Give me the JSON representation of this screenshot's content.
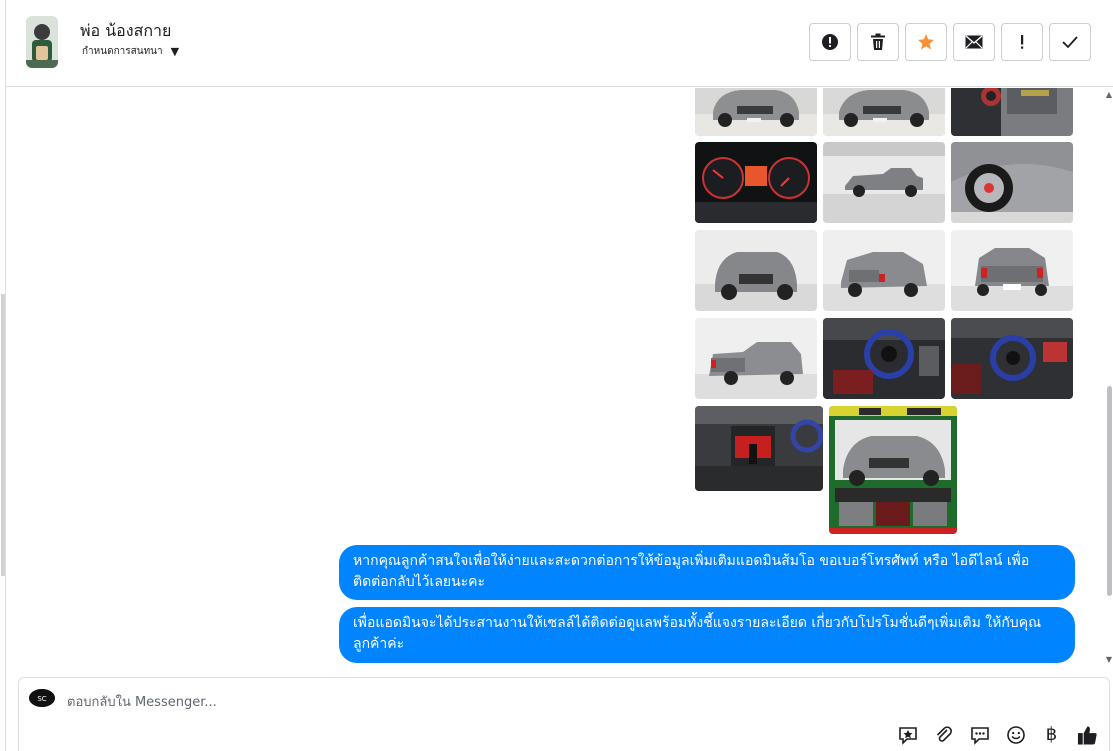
{
  "header": {
    "contact_name": "พ่อ น้องสกาย",
    "assign_label": "กำหนดการสนทนา",
    "actions": [
      {
        "name": "mark-spam-button",
        "glyph": "!",
        "tooltip": ""
      },
      {
        "name": "delete-button",
        "glyph": "trash",
        "tooltip": ""
      },
      {
        "name": "star-button",
        "glyph": "star",
        "tooltip": ""
      },
      {
        "name": "mark-unread-button",
        "glyph": "mail",
        "tooltip": ""
      },
      {
        "name": "follow-up-button",
        "glyph": "!",
        "tooltip": ""
      },
      {
        "name": "mark-done-button",
        "glyph": "check",
        "tooltip": ""
      }
    ]
  },
  "thread": {
    "photos": [
      {
        "name": "photo-truck-front-left"
      },
      {
        "name": "photo-truck-front-right"
      },
      {
        "name": "photo-door-interior"
      },
      {
        "name": "photo-gauge-cluster"
      },
      {
        "name": "photo-truck-side-studio"
      },
      {
        "name": "photo-wheel-closeup"
      },
      {
        "name": "photo-truck-front-studio"
      },
      {
        "name": "photo-truck-rear-left"
      },
      {
        "name": "photo-truck-rear"
      },
      {
        "name": "photo-truck-rear-right"
      },
      {
        "name": "photo-cabin-steering"
      },
      {
        "name": "photo-cabin-dashboard"
      },
      {
        "name": "photo-center-console"
      },
      {
        "name": "photo-promo-poster"
      }
    ],
    "messages": [
      {
        "text": "หากคุณลูกค้าสนใจเพื่อให้ง่ายและสะดวกต่อการให้ข้อมูลเพิ่มเติมแอดมินส้มโอ ขอเบอร์โทรศัพท์ หรือ ไอดีไลน์ เพื่อติดต่อกลับไว้เลยนะคะ"
      },
      {
        "text": "เพื่อแอดมินจะได้ประสานงานให้เซลล์ได้ติดต่อดูแลพร้อมทั้งชี้แจงรายละเอียด เกี่ยวกับโปรโมชั่นดีๆเพิ่มเติม ให้กับคุณลูกค้าค่ะ"
      }
    ]
  },
  "composer": {
    "placeholder": "ตอบกลับใน Messenger...",
    "tools": [
      "saved-reply-icon",
      "attach-icon",
      "chat-bubble-icon",
      "emoji-icon",
      "baht-icon",
      "thumbs-up-icon"
    ],
    "baht_symbol": "฿"
  },
  "colors": {
    "bubble": "#0084ff",
    "star": "#f7923b",
    "border": "#dddfe2"
  }
}
